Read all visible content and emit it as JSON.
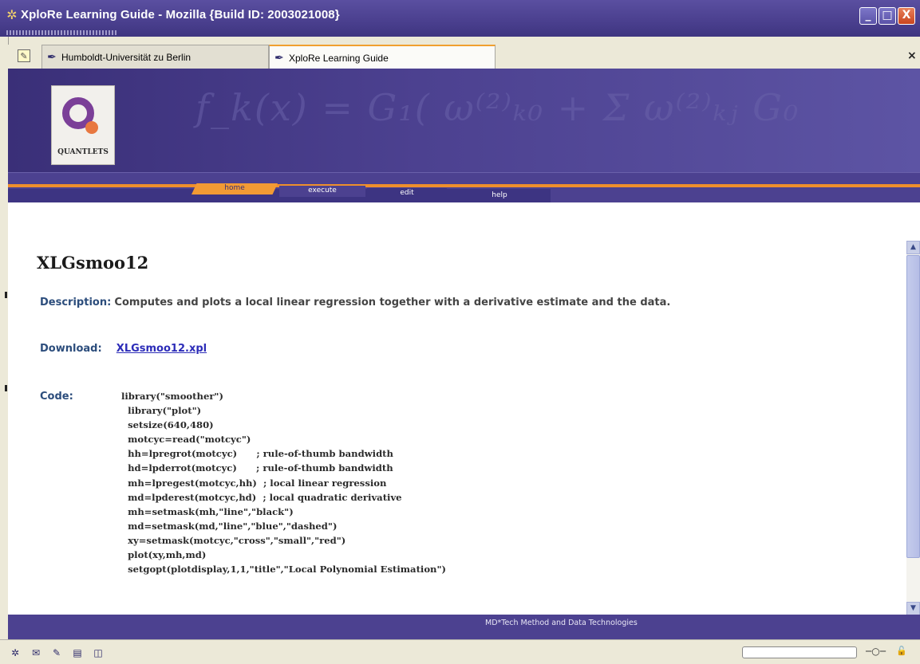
{
  "window": {
    "title": "XploRe Learning Guide - Mozilla {Build ID: 2003021008}",
    "buttons": {
      "minimize": "_",
      "maximize": "□",
      "close": "X"
    }
  },
  "tabs": [
    {
      "label": "Humboldt-Universität zu Berlin",
      "active": false
    },
    {
      "label": "XploRe Learning Guide",
      "active": true
    }
  ],
  "banner": {
    "formula": "f_k(x) = G₁( ω⁽²⁾ₖ₀ + Σ ω⁽²⁾ₖⱼ G₀",
    "logo_text": "QUANTLETS"
  },
  "nav": {
    "home": "home",
    "execute": "execute",
    "edit": "edit",
    "help": "help"
  },
  "page": {
    "heading": "XLGsmoo12",
    "description_label": "Description:",
    "description_text": "Computes and plots a local linear regression together with a derivative estimate and the data.",
    "download_label": "Download:",
    "download_link": "XLGsmoo12.xpl",
    "code_label": "Code:",
    "code": "library(\"smoother\")\n  library(\"plot\")\n  setsize(640,480)\n  motcyc=read(\"motcyc\")\n  hh=lpregrot(motcyc)      ; rule-of-thumb bandwidth\n  hd=lpderrot(motcyc)      ; rule-of-thumb bandwidth\n  mh=lpregest(motcyc,hh)  ; local linear regression\n  md=lpderest(motcyc,hd)  ; local quadratic derivative\n  mh=setmask(mh,\"line\",\"black\")\n  md=setmask(md,\"line\",\"blue\",\"dashed\")\n  xy=setmask(motcyc,\"cross\",\"small\",\"red\")\n  plot(xy,mh,md)\n  setgopt(plotdisplay,1,1,\"title\",\"Local Polynomial Estimation\")"
  },
  "footer": {
    "text": "MD*Tech  Method and Data Technologies"
  },
  "statusbar": {
    "icons": [
      "mozilla-icon",
      "mail-icon",
      "composer-icon",
      "addressbook-icon",
      "irc-icon"
    ],
    "progress": ""
  },
  "colors": {
    "brand_purple": "#4c4190",
    "accent_orange": "#f29a34",
    "link_blue": "#2c2cb8"
  }
}
